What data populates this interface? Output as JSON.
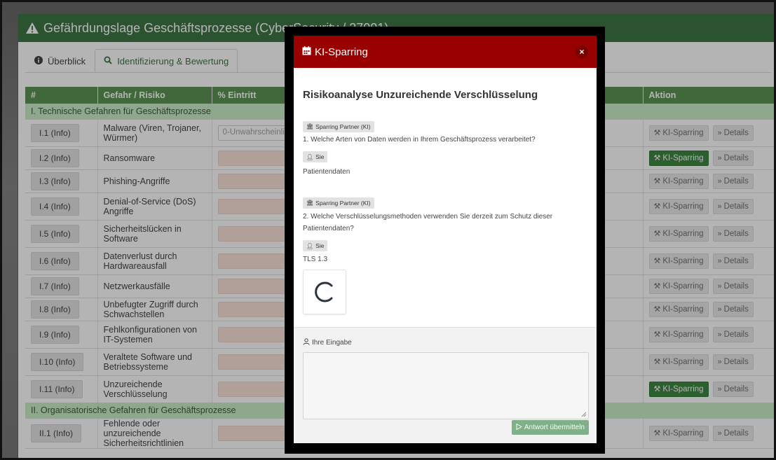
{
  "window": {
    "title": "Gefährdungslage Geschäftsprozesse (CyberSecurity / 27001)"
  },
  "tabs": [
    {
      "label": "Überblick",
      "icon": "info-icon"
    },
    {
      "label": "Identifizierung & Bewertung",
      "icon": "search-icon"
    }
  ],
  "table": {
    "headers": {
      "num": "#",
      "risk": "Gefahr / Risiko",
      "pct": "% Eintritt",
      "action": "Aktion"
    },
    "group1": "I. Technische Gefahren für Geschäftsprozesse",
    "group2": "II. Organisatorische Gefahren für Geschäftsprozesse",
    "first_select": "0-Unwahrscheinlich",
    "rows": [
      {
        "id": "I.1 (Info)",
        "risk": "Malware (Viren, Trojaner, Würmer)"
      },
      {
        "id": "I.2 (Info)",
        "risk": "Ransomware"
      },
      {
        "id": "I.3 (Info)",
        "risk": "Phishing-Angriffe"
      },
      {
        "id": "I.4 (Info)",
        "risk": "Denial-of-Service (DoS) Angriffe"
      },
      {
        "id": "I.5 (Info)",
        "risk": "Sicherheitslücken in Software"
      },
      {
        "id": "I.6 (Info)",
        "risk": "Datenverlust durch Hardwareausfall"
      },
      {
        "id": "I.7 (Info)",
        "risk": "Netzwerkausfälle"
      },
      {
        "id": "I.8 (Info)",
        "risk": "Unbefugter Zugriff durch Schwachstellen"
      },
      {
        "id": "I.9 (Info)",
        "risk": "Fehlkonfigurationen von IT-Systemen"
      },
      {
        "id": "I.10 (Info)",
        "risk": "Veraltete Software und Betriebssysteme"
      },
      {
        "id": "I.11 (Info)",
        "risk": "Unzureichende Verschlüsselung"
      }
    ],
    "row2": {
      "id": "II.1 (Info)",
      "risk": "Fehlende oder unzureichende Sicherheitsrichtlinien"
    },
    "btn_sparring": "KI-Sparring",
    "btn_details": "Details",
    "active_rows": [
      "I.2 (Info)",
      "I.11 (Info)"
    ]
  },
  "modal": {
    "title": "KI-Sparring",
    "close": "×",
    "heading": "Risikoanalyse Unzureichende Verschlüsselung",
    "badge_ai": "Sparring Partner (KI)",
    "badge_user": "Sie",
    "q1": "1. Welche Arten von Daten werden in Ihrem Geschäftsprozess verarbeitet?",
    "a1": "Patientendaten",
    "q2": "2. Welche Verschlüsselungsmethoden verwenden Sie derzeit zum Schutz dieser Patientendaten?",
    "a2": "TLS 1.3",
    "input_label": "Ihre Eingabe",
    "submit": "Antwort übermitteln"
  },
  "colors": {
    "header_green": "#2f6b34",
    "table_head": "#4f8a45",
    "group_bg": "#c7ecc2",
    "modal_red": "#990000",
    "active_btn": "#2f7d32"
  }
}
